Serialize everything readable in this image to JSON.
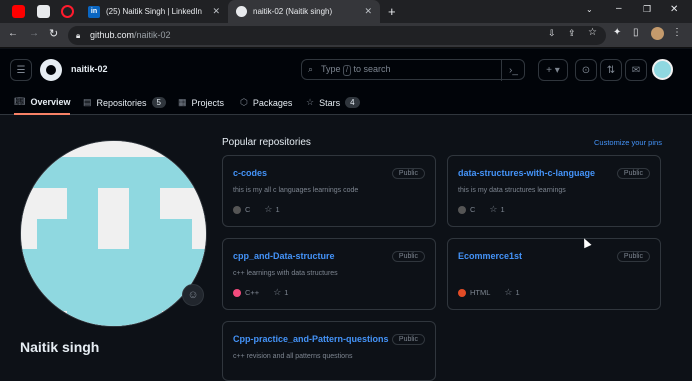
{
  "browser": {
    "tabs": [
      {
        "label": "(25) Naitik Singh | LinkedIn",
        "favicon": "in"
      },
      {
        "label": "naitik-02 (Naitik singh)",
        "favicon": "github"
      }
    ],
    "url_host": "github.com",
    "url_path": "/naitik-02"
  },
  "header": {
    "username": "naitik-02",
    "search_placeholder_before": "Type",
    "search_slash": "/",
    "search_placeholder_after": "to search",
    "plus_label": "+ ▾"
  },
  "nav": {
    "tabs": [
      {
        "label": "Overview",
        "icon": "book-icon"
      },
      {
        "label": "Repositories",
        "count": "5",
        "icon": "repo-icon"
      },
      {
        "label": "Projects",
        "icon": "table-icon"
      },
      {
        "label": "Packages",
        "icon": "package-icon"
      },
      {
        "label": "Stars",
        "count": "4",
        "icon": "star-icon"
      }
    ]
  },
  "profile": {
    "name": "Naitik singh"
  },
  "pinned": {
    "heading": "Popular repositories",
    "customize": "Customize your pins",
    "repos": [
      {
        "name": "c-codes",
        "visibility": "Public",
        "desc": "this is my all c languages learnings code",
        "lang": "C",
        "lang_color": "#555555",
        "stars": "1"
      },
      {
        "name": "data-structures-with-c-language",
        "visibility": "Public",
        "desc": "this is my data structures learnings",
        "lang": "C",
        "lang_color": "#555555",
        "stars": "1"
      },
      {
        "name": "cpp_and-Data-structure",
        "visibility": "Public",
        "desc": "c++ learnings with data structures",
        "lang": "C++",
        "lang_color": "#f34b7d",
        "stars": "1"
      },
      {
        "name": "Ecommerce1st",
        "visibility": "Public",
        "desc": "",
        "lang": "HTML",
        "lang_color": "#e34c26",
        "stars": "1"
      },
      {
        "name": "Cpp-practice_and-Pattern-questions",
        "visibility": "Public",
        "desc": "c++ revision and all patterns questions",
        "lang": "",
        "lang_color": "",
        "stars": ""
      }
    ]
  },
  "colors": {
    "bg": "#0d1117",
    "link": "#4493f8",
    "avatar_teal": "#8fd8e0",
    "tab_underline": "#f78166"
  }
}
